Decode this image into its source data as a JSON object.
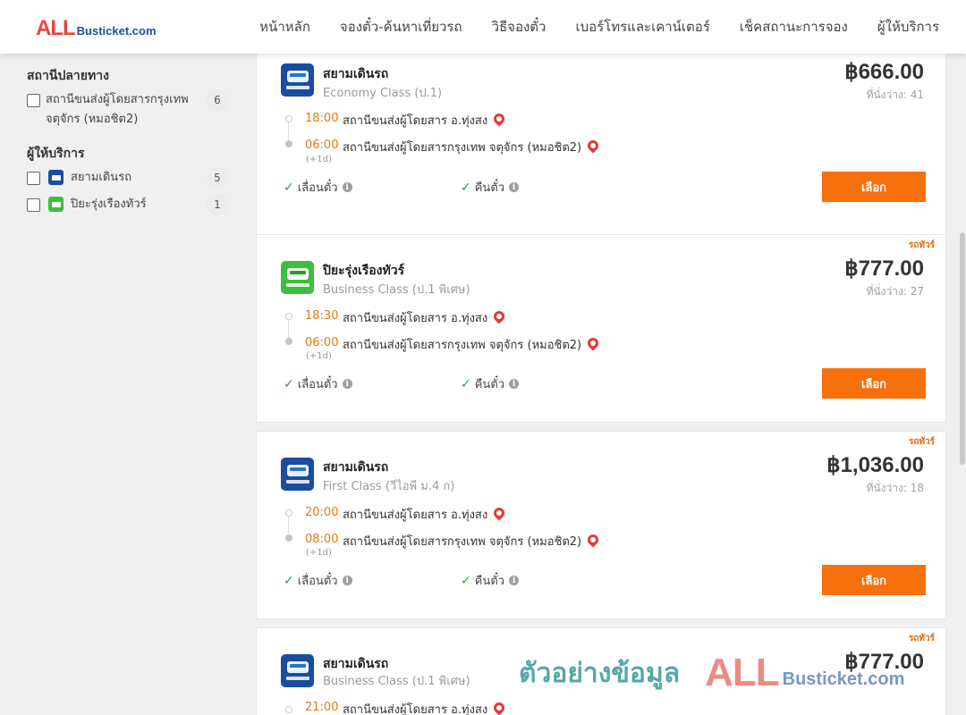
{
  "header": {
    "logo_all": "ALL",
    "logo_rest": "Busticket.com",
    "nav": [
      "หน้าหลัก",
      "จองตั๋ว-ค้นหาเที่ยวรถ",
      "วิธีจองตั๋ว",
      "เบอร์โทรและเคาน์เตอร์",
      "เช็คสถานะการจอง",
      "ผู้ให้บริการ"
    ]
  },
  "sidebar": {
    "destination_title": "สถานีปลายทาง",
    "destination_items": [
      {
        "label": "สถานีขนส่งผู้โดยสารกรุงเทพ จตุจักร (หมอชิต2)",
        "count": "6"
      }
    ],
    "operator_title": "ผู้ให้บริการ",
    "operator_items": [
      {
        "label": "สยามเดินรถ",
        "count": "5",
        "icon": "siam-bus-logo"
      },
      {
        "label": "ปิยะรุ่งเรืองทัวร์",
        "count": "1",
        "icon": "piya-bus-logo"
      }
    ]
  },
  "trips": [
    {
      "tag": "",
      "operator": "สยามเดินรถ",
      "logo": "siam",
      "class": "Economy Class (ป.1)",
      "price": "฿666.00",
      "seats": "ที่นั่งว่าง: 41",
      "depart_time": "18:00",
      "depart_station": "สถานีขนส่งผู้โดยสาร อ.ทุ่งสง",
      "arrive_time": "06:00",
      "arrive_station": "สถานีขนส่งผู้โดยสารกรุงเทพ จตุจักร (หมอชิต2)",
      "next_day": "(+1d)",
      "feature1": "เลื่อนตั๋ว",
      "feature2": "คืนตั๋ว",
      "button": "เลือก"
    },
    {
      "tag": "รถทัวร์",
      "operator": "ปิยะรุ่งเรืองทัวร์",
      "logo": "piya",
      "class": "Business Class (ป.1 พิเศษ)",
      "price": "฿777.00",
      "seats": "ที่นั่งว่าง: 27",
      "depart_time": "18:30",
      "depart_station": "สถานีขนส่งผู้โดยสาร อ.ทุ่งสง",
      "arrive_time": "06:00",
      "arrive_station": "สถานีขนส่งผู้โดยสารกรุงเทพ จตุจักร (หมอชิต2)",
      "next_day": "(+1d)",
      "feature1": "เลื่อนตั๋ว",
      "feature2": "คืนตั๋ว",
      "button": "เลือก"
    },
    {
      "tag": "รถทัวร์",
      "operator": "สยามเดินรถ",
      "logo": "siam",
      "class": "First Class (วีไอพี ม.4 ก)",
      "price": "฿1,036.00",
      "seats": "ที่นั่งว่าง: 18",
      "depart_time": "20:00",
      "depart_station": "สถานีขนส่งผู้โดยสาร อ.ทุ่งสง",
      "arrive_time": "08:00",
      "arrive_station": "สถานีขนส่งผู้โดยสารกรุงเทพ จตุจักร (หมอชิต2)",
      "next_day": "(+1d)",
      "feature1": "เลื่อนตั๋ว",
      "feature2": "คืนตั๋ว",
      "button": "เลือก"
    },
    {
      "tag": "รถทัวร์",
      "operator": "สยามเดินรถ",
      "logo": "siam",
      "class": "Business Class (ป.1 พิเศษ)",
      "price": "฿777.00",
      "seats": "",
      "depart_time": "21:00",
      "depart_station": "สถานีขนส่งผู้โดยสาร อ.ทุ่งสง",
      "arrive_time": "",
      "arrive_station": "",
      "next_day": "",
      "feature1": "",
      "feature2": "",
      "button": ""
    }
  ],
  "watermark": {
    "thai": "ตัวอย่างข้อมูล",
    "all": "ALL",
    "rest": "Busticket.com"
  },
  "colors": {
    "accent_orange": "#f7700b",
    "time_orange": "#e07a10",
    "siam_blue": "#1a4d9e",
    "piya_green": "#3cbf3c",
    "check_green": "#2e9e3e",
    "pin_red": "#e53935"
  }
}
